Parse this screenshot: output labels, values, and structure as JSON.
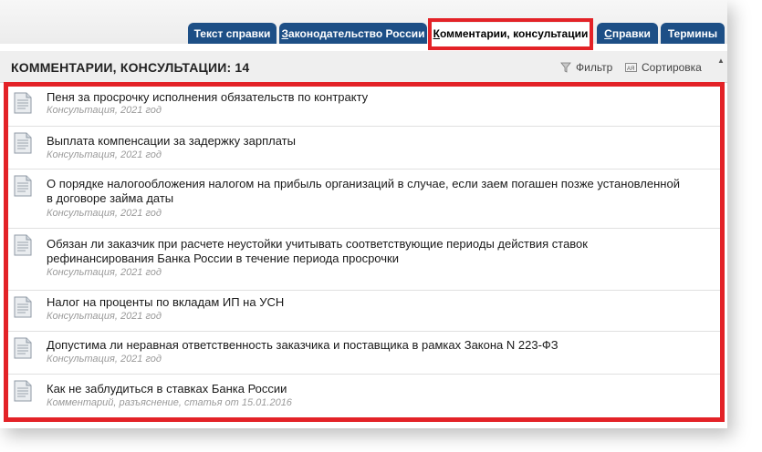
{
  "tabs": [
    {
      "label": "Текст справки",
      "active": false
    },
    {
      "label": "Законодательство России",
      "active": false,
      "underline_char": "З"
    },
    {
      "label": "Комментарии, консультации",
      "active": true,
      "underline_char": "К"
    },
    {
      "label": "Справки",
      "active": false,
      "underline_char": "С"
    },
    {
      "label": "Термины",
      "active": false
    }
  ],
  "header": {
    "title": "КОММЕНТАРИИ, КОНСУЛЬТАЦИИ: 14",
    "filter_label": "Фильтр",
    "sort_label": "Сортировка"
  },
  "items": [
    {
      "title": "Пеня за просрочку исполнения обязательств по контракту",
      "meta": "Консультация, 2021 год"
    },
    {
      "title": "Выплата компенсации за задержку зарплаты",
      "meta": "Консультация, 2021 год"
    },
    {
      "title": "О порядке налогообложения налогом на прибыль организаций в случае, если заем погашен позже установленной в договоре займа даты",
      "meta": "Консультация, 2021 год"
    },
    {
      "title": "Обязан ли заказчик при расчете неустойки учитывать соответствующие периоды действия ставок рефинансирования Банка России в течение периода просрочки",
      "meta": "Консультация, 2021 год"
    },
    {
      "title": "Налог на проценты по вкладам ИП на УСН",
      "meta": "Консультация, 2021 год"
    },
    {
      "title": "Допустима ли неравная ответственность заказчика и поставщика в рамках Закона N 223-ФЗ",
      "meta": "Консультация, 2021 год"
    },
    {
      "title": "Как не заблудиться в ставках Банка России",
      "meta": "Комментарий, разъяснение, статья от 15.01.2016"
    }
  ],
  "colors": {
    "tab_bg": "#1d4f86",
    "highlight": "#e32227",
    "meta_text": "#9a9a9a"
  },
  "icons": {
    "document": "document-icon",
    "filter": "filter-icon",
    "sort": "sort-icon"
  }
}
